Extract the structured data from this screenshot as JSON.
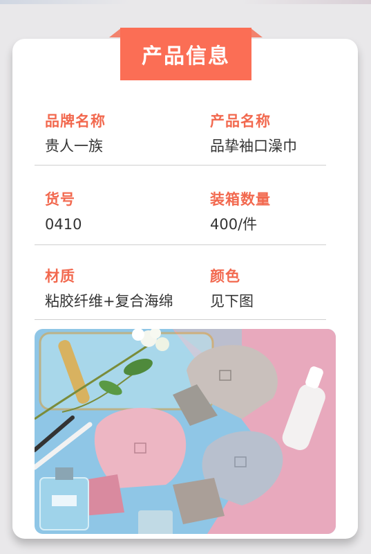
{
  "section": {
    "title": "产品信息"
  },
  "info_rows": [
    {
      "left": {
        "label": "品牌名称",
        "value": "贵人一族"
      },
      "right": {
        "label": "产品名称",
        "value": "品挚袖口澡巾"
      }
    },
    {
      "left": {
        "label": "货号",
        "value": "0410"
      },
      "right": {
        "label": "装箱数量",
        "value": "400/件"
      }
    },
    {
      "left": {
        "label": "材质",
        "value": "粘胶纤维+复合海绵"
      },
      "right": {
        "label": "颜色",
        "value": "见下图"
      }
    }
  ],
  "colors": {
    "accent": "#fb6e55",
    "label": "#f2694f",
    "photo_blue": "#8fc6e6",
    "photo_pink": "#e8a9bd"
  },
  "product_image": {
    "items": [
      "gray-mitt",
      "pink-mitt",
      "blue-gray-mitt",
      "spray-bottle",
      "perfume-bottle",
      "toothbrushes",
      "glass-tray",
      "flowers"
    ]
  }
}
